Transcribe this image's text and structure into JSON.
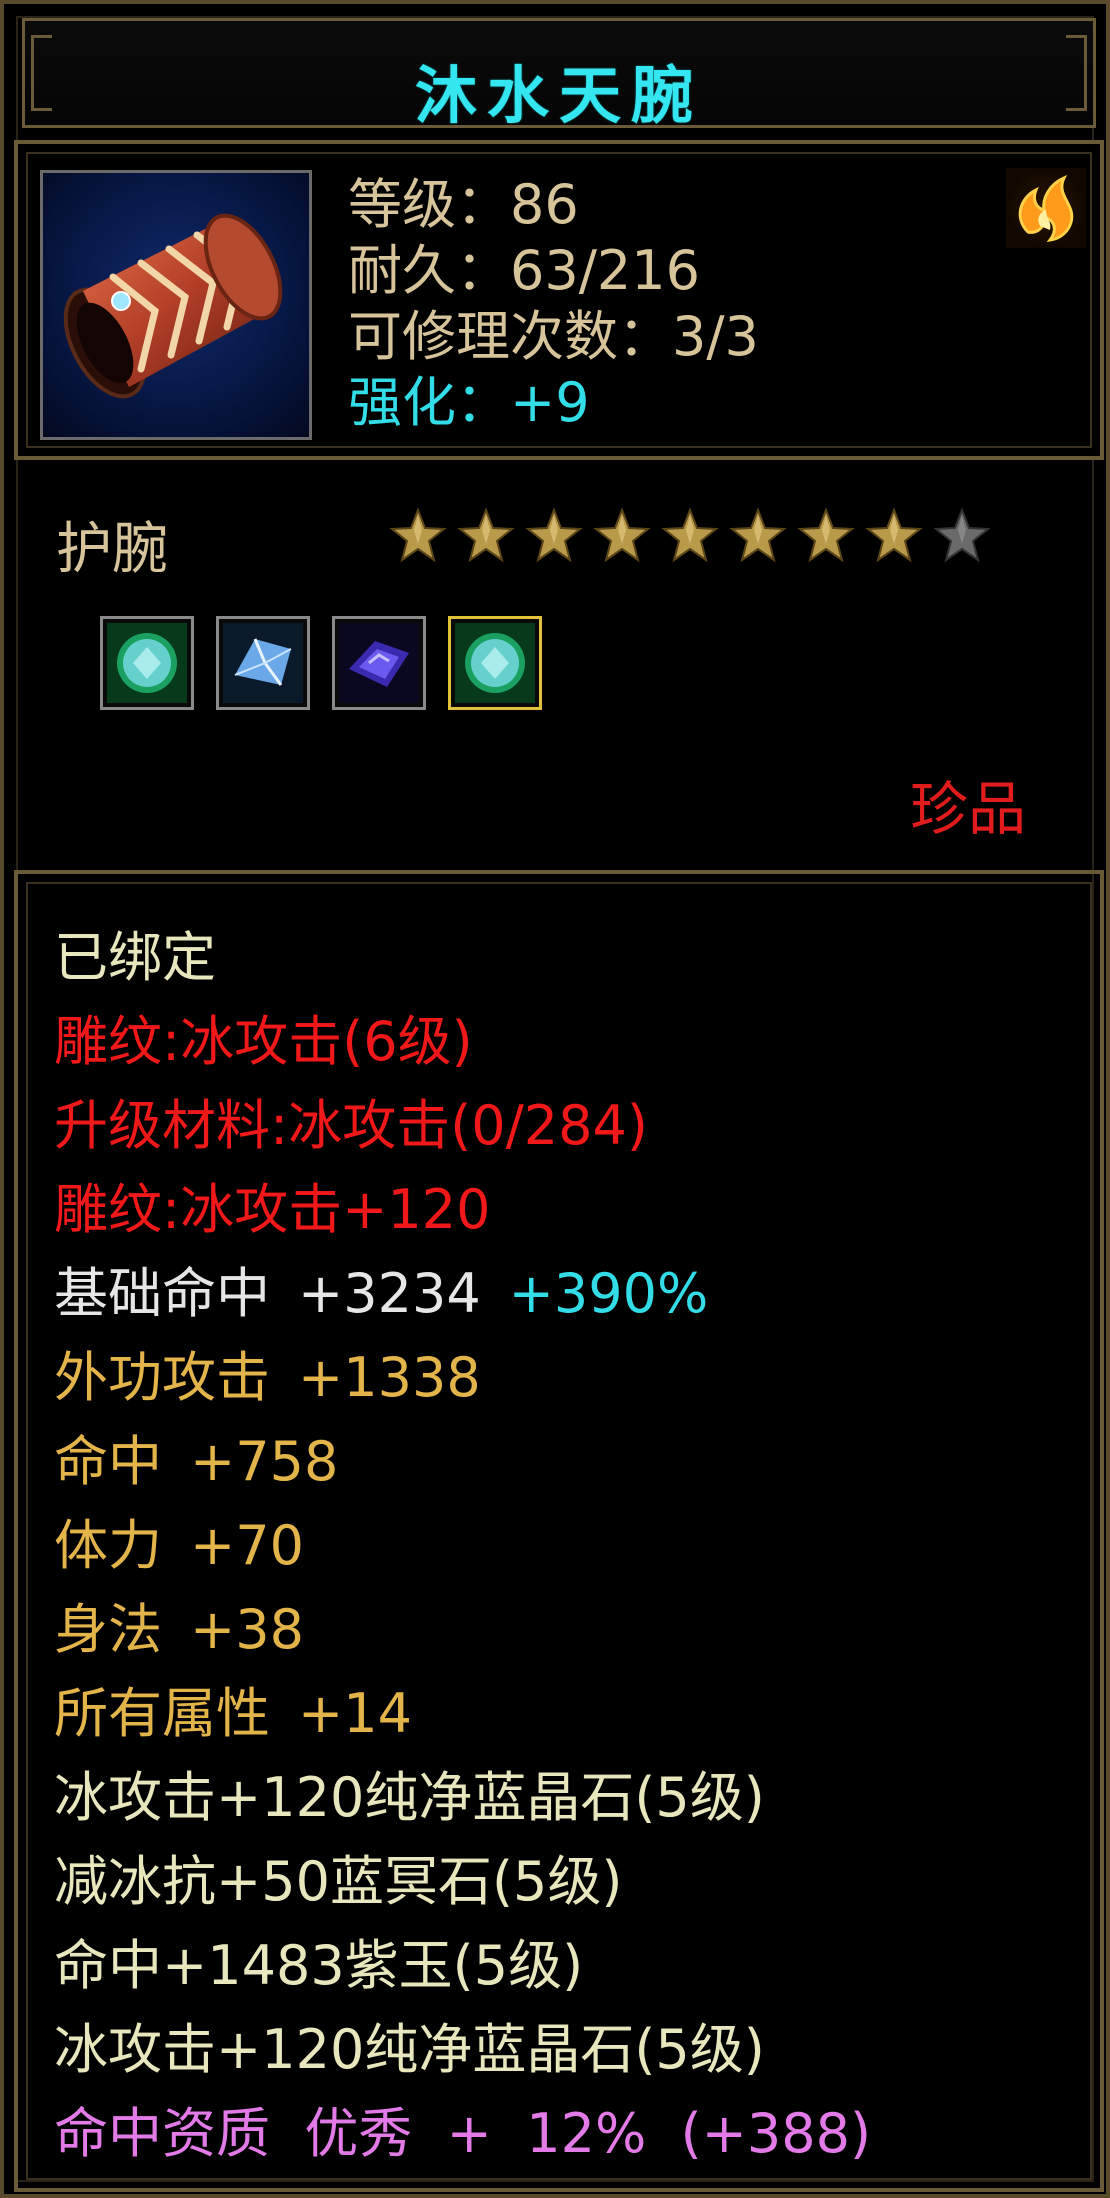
{
  "item": {
    "name": "沐水天腕",
    "level_text": "等级：86",
    "durability_text": "耐久：63/216",
    "repair_text": "可修理次数：3/3",
    "enhance_text": "强化：+9",
    "type": "护腕",
    "stars_filled": 8,
    "stars_total": 9,
    "rarity": "珍品"
  },
  "gems": [
    {
      "icon": "green-crystal-gem-icon",
      "selected": false
    },
    {
      "icon": "blue-diamond-gem-icon",
      "selected": false
    },
    {
      "icon": "purple-jade-gem-icon",
      "selected": false
    },
    {
      "icon": "green-crystal-gem-icon",
      "selected": true
    }
  ],
  "properties": {
    "bound": "已绑定",
    "engrave_1": "雕纹:冰攻击(6级)",
    "upgrade_material": "升级材料:冰攻击(0/284)",
    "engrave_2": "雕纹:冰攻击+120",
    "base_hit_label": "基础命中",
    "base_hit_value": "+3234",
    "base_hit_bonus": "+390%",
    "ext_attack_label": "外功攻击",
    "ext_attack_value": "+1338",
    "hit_label": "命中",
    "hit_value": "+758",
    "stamina_label": "体力",
    "stamina_value": "+70",
    "agility_label": "身法",
    "agility_value": "+38",
    "all_attr_label": "所有属性",
    "all_attr_value": "+14",
    "gem_line_1": "冰攻击+120纯净蓝晶石(5级)",
    "gem_line_2": "减冰抗+50蓝冥石(5级)",
    "gem_line_3": "命中+1483紫玉(5级)",
    "gem_line_4": "冰攻击+120纯净蓝晶石(5级)",
    "aptitude": "命中资质  优秀  +  12%  (+388)"
  },
  "colors": {
    "title_cyan": "#33e6ef",
    "border_gold": "#6a5a38",
    "stat_tan": "#d8c49a",
    "red": "#f01818",
    "gold": "#e2b44a",
    "cream": "#e8e6bc",
    "pink": "#e27ae8"
  }
}
